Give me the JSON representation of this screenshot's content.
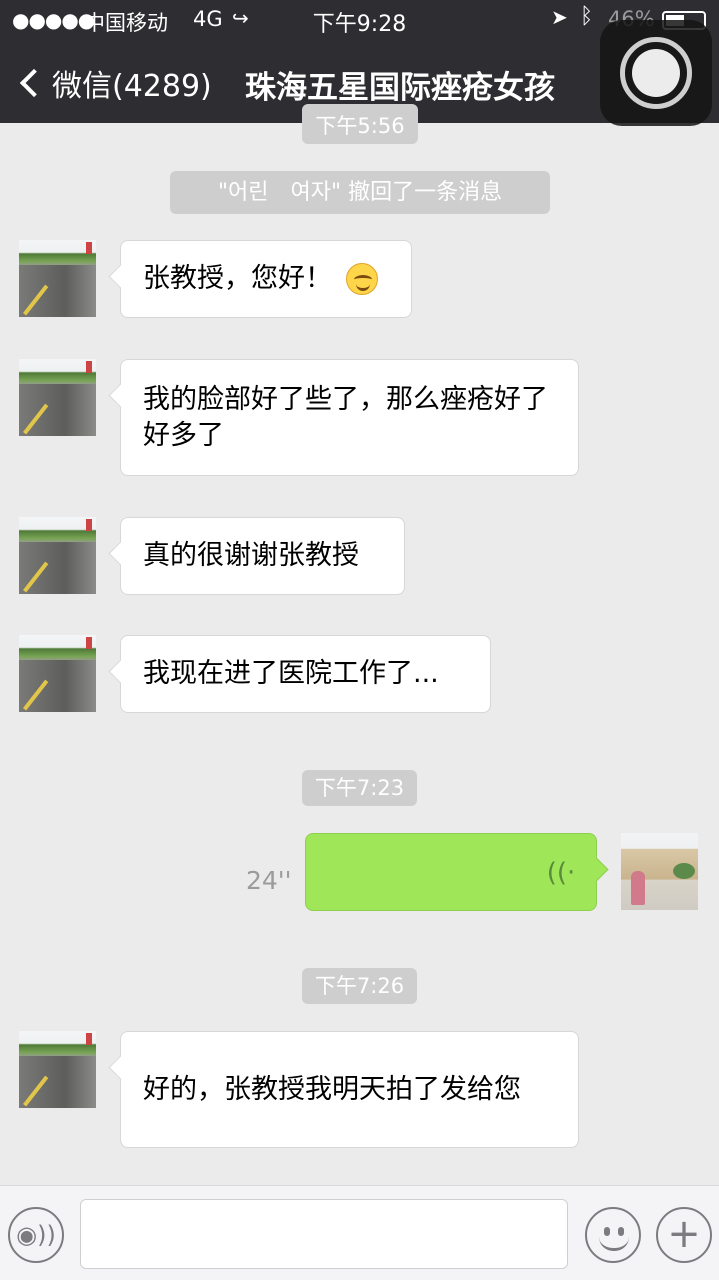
{
  "status_bar": {
    "signal_dots": "●●●●●",
    "carrier": "中国移动",
    "network": "4G",
    "call_icon": "phone-forward-icon",
    "time": "下午9:28",
    "location_icon": "location-arrow-icon",
    "bluetooth_icon": "bluetooth-icon",
    "battery_percent": "46%",
    "battery_level": 0.46
  },
  "nav": {
    "back_label": "微信(4289)",
    "title": "珠海五星国际痤疮女孩"
  },
  "messages": {
    "partial_time": "下午5:56",
    "recall_notice": "\"어린　여자\" 撤回了一条消息",
    "m1": "张教授，您好！",
    "m2": "我的脸部好了些了，那么痤疮好了好多了",
    "m3": "真的很谢谢张教授",
    "m4": "我现在进了医院工作了...",
    "time2": "下午7:23",
    "voice_duration": "24''",
    "time3": "下午7:26",
    "m5": "好的，张教授我明天拍了发给您"
  },
  "input_bar": {
    "voice_toggle_glyph": "◉))",
    "plus_glyph": "+"
  }
}
